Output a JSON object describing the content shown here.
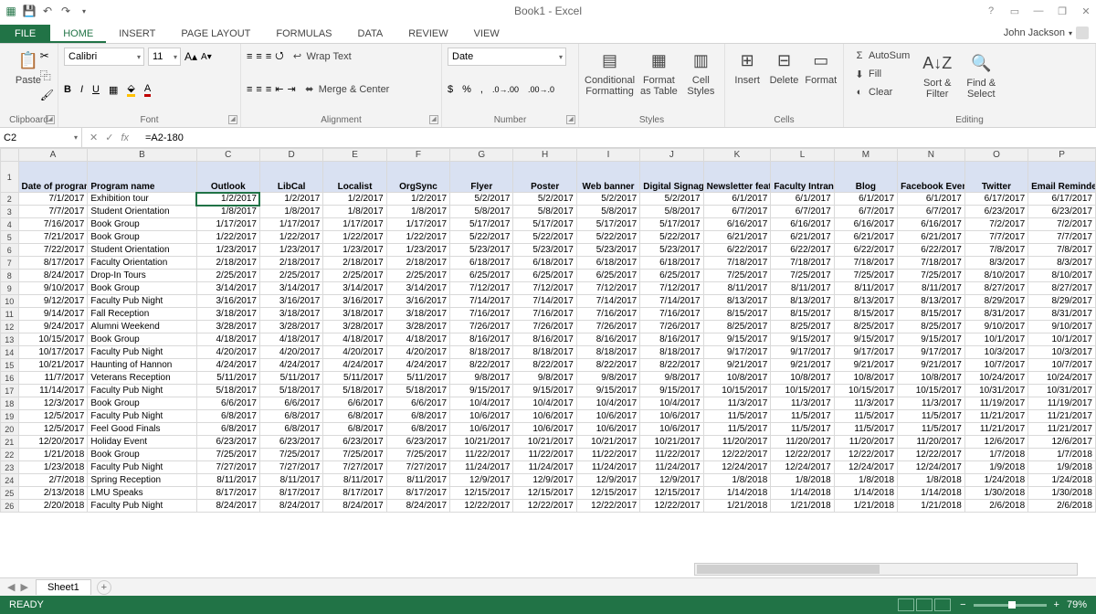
{
  "title": "Book1 - Excel",
  "user": "John Jackson",
  "tabs": {
    "file": "FILE",
    "list": [
      "HOME",
      "INSERT",
      "PAGE LAYOUT",
      "FORMULAS",
      "DATA",
      "REVIEW",
      "VIEW"
    ],
    "active": 0
  },
  "ribbon": {
    "clipboard": {
      "paste": "Paste",
      "label": "Clipboard"
    },
    "font": {
      "name": "Calibri",
      "size": "11",
      "label": "Font"
    },
    "alignment": {
      "wrap": "Wrap Text",
      "merge": "Merge & Center",
      "label": "Alignment"
    },
    "number": {
      "format": "Date",
      "label": "Number"
    },
    "styles": {
      "cond": "Conditional Formatting",
      "fmt": "Format as Table",
      "cell": "Cell Styles",
      "label": "Styles"
    },
    "cells": {
      "insert": "Insert",
      "delete": "Delete",
      "format": "Format",
      "label": "Cells"
    },
    "editing": {
      "autosum": "AutoSum",
      "fill": "Fill",
      "clear": "Clear",
      "sort": "Sort & Filter",
      "find": "Find & Select",
      "label": "Editing"
    }
  },
  "namebox": "C2",
  "formula": "=A2-180",
  "columns": [
    "",
    "A",
    "B",
    "C",
    "D",
    "E",
    "F",
    "G",
    "H",
    "I",
    "J",
    "K",
    "L",
    "M",
    "N",
    "O",
    "P"
  ],
  "header_row": [
    "Date of program",
    "Program name",
    "Outlook",
    "LibCal",
    "Localist",
    "OrgSync",
    "Flyer",
    "Poster",
    "Web banner",
    "Digital Signage",
    "Newsletter feature",
    "Faculty Intranet",
    "Blog",
    "Facebook Event",
    "Twitter",
    "Email Reminder"
  ],
  "rows": [
    {
      "n": 2,
      "date": "7/1/2017",
      "name": "Exhibition tour",
      "d": [
        "1/2/2017",
        "1/2/2017",
        "1/2/2017",
        "1/2/2017",
        "5/2/2017",
        "5/2/2017",
        "5/2/2017",
        "5/2/2017",
        "6/1/2017",
        "6/1/2017",
        "6/1/2017",
        "6/1/2017",
        "6/17/2017",
        "6/17/2017"
      ]
    },
    {
      "n": 3,
      "date": "7/7/2017",
      "name": "Student Orientation",
      "d": [
        "1/8/2017",
        "1/8/2017",
        "1/8/2017",
        "1/8/2017",
        "5/8/2017",
        "5/8/2017",
        "5/8/2017",
        "5/8/2017",
        "6/7/2017",
        "6/7/2017",
        "6/7/2017",
        "6/7/2017",
        "6/23/2017",
        "6/23/2017"
      ]
    },
    {
      "n": 4,
      "date": "7/16/2017",
      "name": "Book Group",
      "d": [
        "1/17/2017",
        "1/17/2017",
        "1/17/2017",
        "1/17/2017",
        "5/17/2017",
        "5/17/2017",
        "5/17/2017",
        "5/17/2017",
        "6/16/2017",
        "6/16/2017",
        "6/16/2017",
        "6/16/2017",
        "7/2/2017",
        "7/2/2017"
      ]
    },
    {
      "n": 5,
      "date": "7/21/2017",
      "name": "Book Group",
      "d": [
        "1/22/2017",
        "1/22/2017",
        "1/22/2017",
        "1/22/2017",
        "5/22/2017",
        "5/22/2017",
        "5/22/2017",
        "5/22/2017",
        "6/21/2017",
        "6/21/2017",
        "6/21/2017",
        "6/21/2017",
        "7/7/2017",
        "7/7/2017"
      ]
    },
    {
      "n": 6,
      "date": "7/22/2017",
      "name": "Student Orientation",
      "d": [
        "1/23/2017",
        "1/23/2017",
        "1/23/2017",
        "1/23/2017",
        "5/23/2017",
        "5/23/2017",
        "5/23/2017",
        "5/23/2017",
        "6/22/2017",
        "6/22/2017",
        "6/22/2017",
        "6/22/2017",
        "7/8/2017",
        "7/8/2017"
      ]
    },
    {
      "n": 7,
      "date": "8/17/2017",
      "name": "Faculty Orientation",
      "d": [
        "2/18/2017",
        "2/18/2017",
        "2/18/2017",
        "2/18/2017",
        "6/18/2017",
        "6/18/2017",
        "6/18/2017",
        "6/18/2017",
        "7/18/2017",
        "7/18/2017",
        "7/18/2017",
        "7/18/2017",
        "8/3/2017",
        "8/3/2017"
      ]
    },
    {
      "n": 8,
      "date": "8/24/2017",
      "name": "Drop-In Tours",
      "d": [
        "2/25/2017",
        "2/25/2017",
        "2/25/2017",
        "2/25/2017",
        "6/25/2017",
        "6/25/2017",
        "6/25/2017",
        "6/25/2017",
        "7/25/2017",
        "7/25/2017",
        "7/25/2017",
        "7/25/2017",
        "8/10/2017",
        "8/10/2017"
      ]
    },
    {
      "n": 9,
      "date": "9/10/2017",
      "name": "Book Group",
      "d": [
        "3/14/2017",
        "3/14/2017",
        "3/14/2017",
        "3/14/2017",
        "7/12/2017",
        "7/12/2017",
        "7/12/2017",
        "7/12/2017",
        "8/11/2017",
        "8/11/2017",
        "8/11/2017",
        "8/11/2017",
        "8/27/2017",
        "8/27/2017"
      ]
    },
    {
      "n": 10,
      "date": "9/12/2017",
      "name": "Faculty Pub Night",
      "d": [
        "3/16/2017",
        "3/16/2017",
        "3/16/2017",
        "3/16/2017",
        "7/14/2017",
        "7/14/2017",
        "7/14/2017",
        "7/14/2017",
        "8/13/2017",
        "8/13/2017",
        "8/13/2017",
        "8/13/2017",
        "8/29/2017",
        "8/29/2017"
      ]
    },
    {
      "n": 11,
      "date": "9/14/2017",
      "name": "Fall Reception",
      "d": [
        "3/18/2017",
        "3/18/2017",
        "3/18/2017",
        "3/18/2017",
        "7/16/2017",
        "7/16/2017",
        "7/16/2017",
        "7/16/2017",
        "8/15/2017",
        "8/15/2017",
        "8/15/2017",
        "8/15/2017",
        "8/31/2017",
        "8/31/2017"
      ]
    },
    {
      "n": 12,
      "date": "9/24/2017",
      "name": "Alumni Weekend",
      "d": [
        "3/28/2017",
        "3/28/2017",
        "3/28/2017",
        "3/28/2017",
        "7/26/2017",
        "7/26/2017",
        "7/26/2017",
        "7/26/2017",
        "8/25/2017",
        "8/25/2017",
        "8/25/2017",
        "8/25/2017",
        "9/10/2017",
        "9/10/2017"
      ]
    },
    {
      "n": 13,
      "date": "10/15/2017",
      "name": "Book Group",
      "d": [
        "4/18/2017",
        "4/18/2017",
        "4/18/2017",
        "4/18/2017",
        "8/16/2017",
        "8/16/2017",
        "8/16/2017",
        "8/16/2017",
        "9/15/2017",
        "9/15/2017",
        "9/15/2017",
        "9/15/2017",
        "10/1/2017",
        "10/1/2017"
      ]
    },
    {
      "n": 14,
      "date": "10/17/2017",
      "name": "Faculty Pub Night",
      "d": [
        "4/20/2017",
        "4/20/2017",
        "4/20/2017",
        "4/20/2017",
        "8/18/2017",
        "8/18/2017",
        "8/18/2017",
        "8/18/2017",
        "9/17/2017",
        "9/17/2017",
        "9/17/2017",
        "9/17/2017",
        "10/3/2017",
        "10/3/2017"
      ]
    },
    {
      "n": 15,
      "date": "10/21/2017",
      "name": "Haunting of Hannon",
      "d": [
        "4/24/2017",
        "4/24/2017",
        "4/24/2017",
        "4/24/2017",
        "8/22/2017",
        "8/22/2017",
        "8/22/2017",
        "8/22/2017",
        "9/21/2017",
        "9/21/2017",
        "9/21/2017",
        "9/21/2017",
        "10/7/2017",
        "10/7/2017"
      ]
    },
    {
      "n": 16,
      "date": "11/7/2017",
      "name": "Veterans Reception",
      "d": [
        "5/11/2017",
        "5/11/2017",
        "5/11/2017",
        "5/11/2017",
        "9/8/2017",
        "9/8/2017",
        "9/8/2017",
        "9/8/2017",
        "10/8/2017",
        "10/8/2017",
        "10/8/2017",
        "10/8/2017",
        "10/24/2017",
        "10/24/2017"
      ]
    },
    {
      "n": 17,
      "date": "11/14/2017",
      "name": "Faculty Pub Night",
      "d": [
        "5/18/2017",
        "5/18/2017",
        "5/18/2017",
        "5/18/2017",
        "9/15/2017",
        "9/15/2017",
        "9/15/2017",
        "9/15/2017",
        "10/15/2017",
        "10/15/2017",
        "10/15/2017",
        "10/15/2017",
        "10/31/2017",
        "10/31/2017"
      ]
    },
    {
      "n": 18,
      "date": "12/3/2017",
      "name": "Book Group",
      "d": [
        "6/6/2017",
        "6/6/2017",
        "6/6/2017",
        "6/6/2017",
        "10/4/2017",
        "10/4/2017",
        "10/4/2017",
        "10/4/2017",
        "11/3/2017",
        "11/3/2017",
        "11/3/2017",
        "11/3/2017",
        "11/19/2017",
        "11/19/2017"
      ]
    },
    {
      "n": 19,
      "date": "12/5/2017",
      "name": "Faculty Pub Night",
      "d": [
        "6/8/2017",
        "6/8/2017",
        "6/8/2017",
        "6/8/2017",
        "10/6/2017",
        "10/6/2017",
        "10/6/2017",
        "10/6/2017",
        "11/5/2017",
        "11/5/2017",
        "11/5/2017",
        "11/5/2017",
        "11/21/2017",
        "11/21/2017"
      ]
    },
    {
      "n": 20,
      "date": "12/5/2017",
      "name": "Feel Good Finals",
      "d": [
        "6/8/2017",
        "6/8/2017",
        "6/8/2017",
        "6/8/2017",
        "10/6/2017",
        "10/6/2017",
        "10/6/2017",
        "10/6/2017",
        "11/5/2017",
        "11/5/2017",
        "11/5/2017",
        "11/5/2017",
        "11/21/2017",
        "11/21/2017"
      ]
    },
    {
      "n": 21,
      "date": "12/20/2017",
      "name": "Holiday Event",
      "d": [
        "6/23/2017",
        "6/23/2017",
        "6/23/2017",
        "6/23/2017",
        "10/21/2017",
        "10/21/2017",
        "10/21/2017",
        "10/21/2017",
        "11/20/2017",
        "11/20/2017",
        "11/20/2017",
        "11/20/2017",
        "12/6/2017",
        "12/6/2017"
      ]
    },
    {
      "n": 22,
      "date": "1/21/2018",
      "name": "Book Group",
      "d": [
        "7/25/2017",
        "7/25/2017",
        "7/25/2017",
        "7/25/2017",
        "11/22/2017",
        "11/22/2017",
        "11/22/2017",
        "11/22/2017",
        "12/22/2017",
        "12/22/2017",
        "12/22/2017",
        "12/22/2017",
        "1/7/2018",
        "1/7/2018"
      ]
    },
    {
      "n": 23,
      "date": "1/23/2018",
      "name": "Faculty Pub Night",
      "d": [
        "7/27/2017",
        "7/27/2017",
        "7/27/2017",
        "7/27/2017",
        "11/24/2017",
        "11/24/2017",
        "11/24/2017",
        "11/24/2017",
        "12/24/2017",
        "12/24/2017",
        "12/24/2017",
        "12/24/2017",
        "1/9/2018",
        "1/9/2018"
      ]
    },
    {
      "n": 24,
      "date": "2/7/2018",
      "name": "Spring Reception",
      "d": [
        "8/11/2017",
        "8/11/2017",
        "8/11/2017",
        "8/11/2017",
        "12/9/2017",
        "12/9/2017",
        "12/9/2017",
        "12/9/2017",
        "1/8/2018",
        "1/8/2018",
        "1/8/2018",
        "1/8/2018",
        "1/24/2018",
        "1/24/2018"
      ]
    },
    {
      "n": 25,
      "date": "2/13/2018",
      "name": "LMU Speaks",
      "d": [
        "8/17/2017",
        "8/17/2017",
        "8/17/2017",
        "8/17/2017",
        "12/15/2017",
        "12/15/2017",
        "12/15/2017",
        "12/15/2017",
        "1/14/2018",
        "1/14/2018",
        "1/14/2018",
        "1/14/2018",
        "1/30/2018",
        "1/30/2018"
      ]
    },
    {
      "n": 26,
      "date": "2/20/2018",
      "name": "Faculty Pub Night",
      "d": [
        "8/24/2017",
        "8/24/2017",
        "8/24/2017",
        "8/24/2017",
        "12/22/2017",
        "12/22/2017",
        "12/22/2017",
        "12/22/2017",
        "1/21/2018",
        "1/21/2018",
        "1/21/2018",
        "1/21/2018",
        "2/6/2018",
        "2/6/2018"
      ]
    }
  ],
  "sheet_tab": "Sheet1",
  "status": "READY",
  "zoom": "79%"
}
